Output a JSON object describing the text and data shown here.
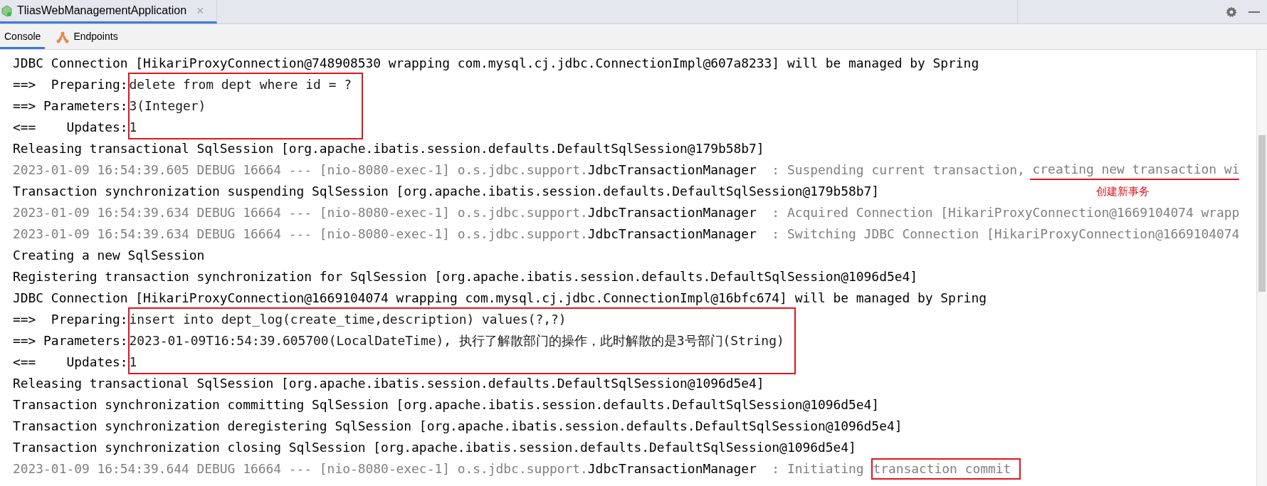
{
  "run_tab": {
    "title": "TliasWebManagementApplication",
    "close": "×",
    "selected": true
  },
  "tool_tabs": [
    {
      "label": "Console",
      "selected": true
    },
    {
      "label": "Endpoints",
      "selected": false
    }
  ],
  "console": {
    "annotation": "创建新事务",
    "lines": [
      {
        "kind": "text",
        "text": "JDBC Connection [HikariProxyConnection@748908530 wrapping com.mysql.cj.jdbc.ConnectionImpl@607a8233] will be managed by Spring"
      },
      {
        "kind": "sql",
        "boxed": true,
        "rows": [
          {
            "label": "==>  Preparing:",
            "value": "delete from dept where id = ?"
          },
          {
            "label": "==> Parameters:",
            "value": "3(Integer)"
          },
          {
            "label": "<==    Updates:",
            "value": "1"
          }
        ]
      },
      {
        "kind": "text",
        "text": "Releasing transactional SqlSession [org.apache.ibatis.session.defaults.DefaultSqlSession@179b58b7]"
      },
      {
        "kind": "log",
        "prefix": "2023-01-09 16:54:39.605 DEBUG 16664 --- [nio-8080-exec-1] o.s.jdbc.support.",
        "logger": "JdbcTransactionManager",
        "message": "  : Suspending current transaction, ",
        "highlight": "creating new transaction wi",
        "underlined": true
      },
      {
        "kind": "text",
        "text": "Transaction synchronization suspending SqlSession [org.apache.ibatis.session.defaults.DefaultSqlSession@179b58b7]"
      },
      {
        "kind": "log",
        "prefix": "2023-01-09 16:54:39.634 DEBUG 16664 --- [nio-8080-exec-1] o.s.jdbc.support.",
        "logger": "JdbcTransactionManager",
        "message": "  : Acquired Connection [HikariProxyConnection@1669104074 wrapp"
      },
      {
        "kind": "log",
        "prefix": "2023-01-09 16:54:39.634 DEBUG 16664 --- [nio-8080-exec-1] o.s.jdbc.support.",
        "logger": "JdbcTransactionManager",
        "message": "  : Switching JDBC Connection [HikariProxyConnection@1669104074"
      },
      {
        "kind": "text",
        "text": "Creating a new SqlSession"
      },
      {
        "kind": "text",
        "text": "Registering transaction synchronization for SqlSession [org.apache.ibatis.session.defaults.DefaultSqlSession@1096d5e4]"
      },
      {
        "kind": "text",
        "text": "JDBC Connection [HikariProxyConnection@1669104074 wrapping com.mysql.cj.jdbc.ConnectionImpl@16bfc674] will be managed by Spring"
      },
      {
        "kind": "sql",
        "boxed": true,
        "rows": [
          {
            "label": "==>  Preparing:",
            "value": "insert into dept_log(create_time,description) values(?,?)"
          },
          {
            "label": "==> Parameters:",
            "value": "2023-01-09T16:54:39.605700(LocalDateTime), 执行了解散部门的操作，此时解散的是3号部门(String)"
          },
          {
            "label": "<==    Updates:",
            "value": "1"
          }
        ]
      },
      {
        "kind": "text",
        "text": "Releasing transactional SqlSession [org.apache.ibatis.session.defaults.DefaultSqlSession@1096d5e4]"
      },
      {
        "kind": "text",
        "text": "Transaction synchronization committing SqlSession [org.apache.ibatis.session.defaults.DefaultSqlSession@1096d5e4]"
      },
      {
        "kind": "text",
        "text": "Transaction synchronization deregistering SqlSession [org.apache.ibatis.session.defaults.DefaultSqlSession@1096d5e4]"
      },
      {
        "kind": "text",
        "text": "Transaction synchronization closing SqlSession [org.apache.ibatis.session.defaults.DefaultSqlSession@1096d5e4]"
      },
      {
        "kind": "log",
        "prefix": "2023-01-09 16:54:39.644 DEBUG 16664 --- [nio-8080-exec-1] o.s.jdbc.support.",
        "logger": "JdbcTransactionManager",
        "message": "  : Initiating ",
        "highlight": "transaction commit",
        "boxed": true
      }
    ]
  }
}
